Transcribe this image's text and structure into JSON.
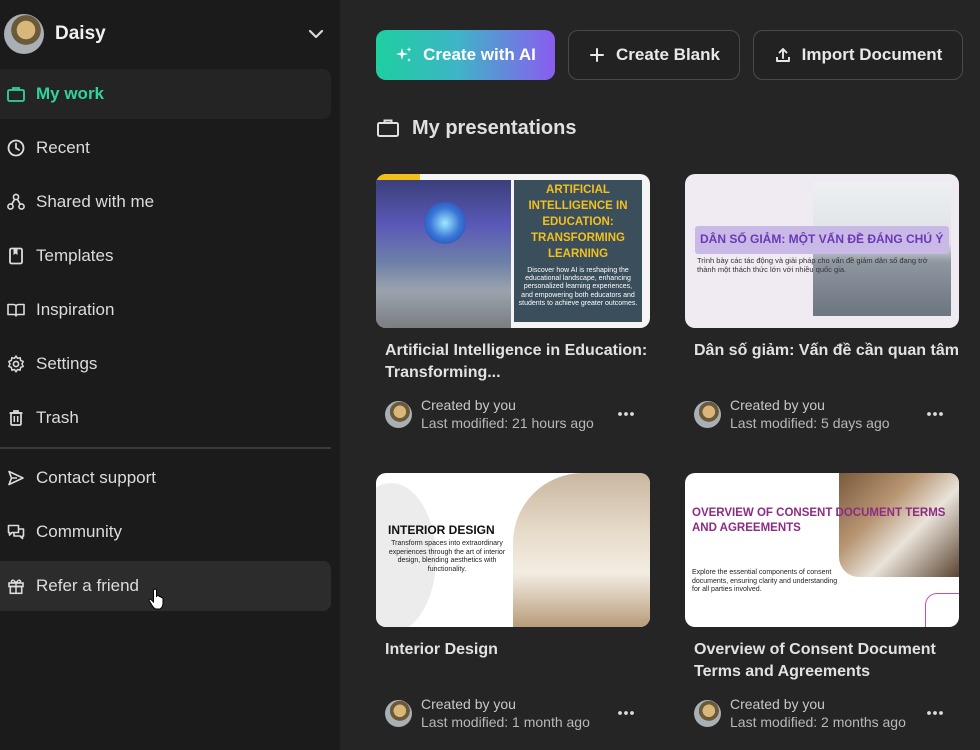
{
  "user": {
    "name": "Daisy"
  },
  "sidebar": {
    "items": [
      {
        "key": "my-work",
        "label": "My work",
        "icon": "briefcase-icon"
      },
      {
        "key": "recent",
        "label": "Recent",
        "icon": "clock-icon"
      },
      {
        "key": "shared",
        "label": "Shared with me",
        "icon": "share-nodes-icon"
      },
      {
        "key": "templates",
        "label": "Templates",
        "icon": "bookmark-icon"
      },
      {
        "key": "inspiration",
        "label": "Inspiration",
        "icon": "open-book-icon"
      },
      {
        "key": "settings",
        "label": "Settings",
        "icon": "gear-icon"
      },
      {
        "key": "trash",
        "label": "Trash",
        "icon": "trash-icon"
      }
    ],
    "bottom_items": [
      {
        "key": "contact",
        "label": "Contact support",
        "icon": "send-icon"
      },
      {
        "key": "community",
        "label": "Community",
        "icon": "chat-icon"
      },
      {
        "key": "refer",
        "label": "Refer a friend",
        "icon": "gift-icon"
      }
    ]
  },
  "toolbar": {
    "create_ai": "Create with AI",
    "create_blank": "Create Blank",
    "import_document": "Import Document"
  },
  "main": {
    "section_title": "My presentations"
  },
  "presentations": [
    {
      "title": "Artificial Intelligence in Education: Transforming...",
      "created_by": "Created by you",
      "modified": "Last modified: 21 hours ago",
      "thumb_title": "ARTIFICIAL INTELLIGENCE IN EDUCATION: TRANSFORMING LEARNING",
      "thumb_body": "Discover how AI is reshaping the educational landscape, enhancing personalized learning experiences, and empowering both educators and students to achieve greater outcomes."
    },
    {
      "title": "Dân số giảm: Vấn đề cần quan tâm",
      "created_by": "Created by you",
      "modified": "Last modified: 5 days ago",
      "thumb_title": "DÂN SỐ GIẢM: MỘT VẤN ĐỀ ĐÁNG CHÚ Ý",
      "thumb_body": "Trình bày các tác động và giải pháp cho vấn đề giảm dân số đang trở thành một thách thức lớn với nhiều quốc gia."
    },
    {
      "title": "Interior Design",
      "created_by": "Created by you",
      "modified": "Last modified: 1 month ago",
      "thumb_title": "INTERIOR DESIGN",
      "thumb_body": "Transform spaces into extraordinary experiences through the art of interior design, blending aesthetics with functionality."
    },
    {
      "title": "Overview of Consent Document Terms and Agreements",
      "created_by": "Created by you",
      "modified": "Last modified: 2 months ago",
      "thumb_title": "OVERVIEW OF CONSENT DOCUMENT TERMS AND AGREEMENTS",
      "thumb_body": "Explore the essential components of consent documents, ensuring clarity and understanding for all parties involved."
    }
  ],
  "colors": {
    "accent": "#2fd3a0",
    "background": "#252525",
    "sidebar": "#1b1b1b"
  }
}
